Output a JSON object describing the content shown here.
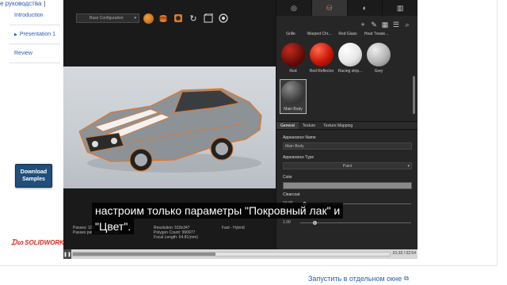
{
  "top_link": "е руководства",
  "nav": {
    "items": [
      {
        "label": "Introduction",
        "arrow": false
      },
      {
        "label": "Presentation 1",
        "arrow": true
      },
      {
        "label": "Review",
        "arrow": false
      }
    ]
  },
  "download_button": {
    "line1": "Download",
    "line2": "Samples"
  },
  "logo": {
    "text": "SOLIDWORKS"
  },
  "viewport": {
    "config_select": "Base Configuration",
    "status": {
      "passes": "Passes: 100",
      "passes_per_second": "Passes per second: 10.00",
      "resolution": "Resolution: 518x347",
      "polygon_count": "Polygon Count: 990977",
      "focal_length": "Focal Length: 54.81(mm)",
      "mode": "Fast - Hybrid"
    }
  },
  "panel": {
    "material_names_top": [
      "Grille",
      "Warped Chr...",
      "Red Glass",
      "Heat Treate..."
    ],
    "materials": [
      {
        "name": "Red",
        "color": "#8a0f0a"
      },
      {
        "name": "Red Reflector",
        "color": "#e0210f"
      },
      {
        "name": "Racing strip...",
        "color": "#f2f2f2"
      },
      {
        "name": "Grey",
        "color": "#bdbdbd"
      },
      {
        "name": "Main Body",
        "color": "#4a4a4a"
      }
    ],
    "sub_tabs": [
      "General",
      "Texture",
      "Texture Mapping"
    ],
    "appearance_name_label": "Appearance Name",
    "appearance_name_value": "Main Body",
    "appearance_type_label": "Appearance Type",
    "appearance_type_value": "Paint",
    "color_label": "Color",
    "clearcoat_label": "Clearcoat",
    "clearcoat_value": "10.00",
    "second_value": "1.00"
  },
  "subtitle": {
    "line1": "настроим только параметры \"Покровный лак\" и",
    "line2": "\"Цвет\"."
  },
  "player": {
    "time": "01:33 / 02:54",
    "progress": 0.45
  },
  "open_link": "Запустить в отдельном окне",
  "colors": {
    "link": "#2a5db0",
    "accent_orange": "#e8743a",
    "button_blue": "#1f4f7a"
  }
}
